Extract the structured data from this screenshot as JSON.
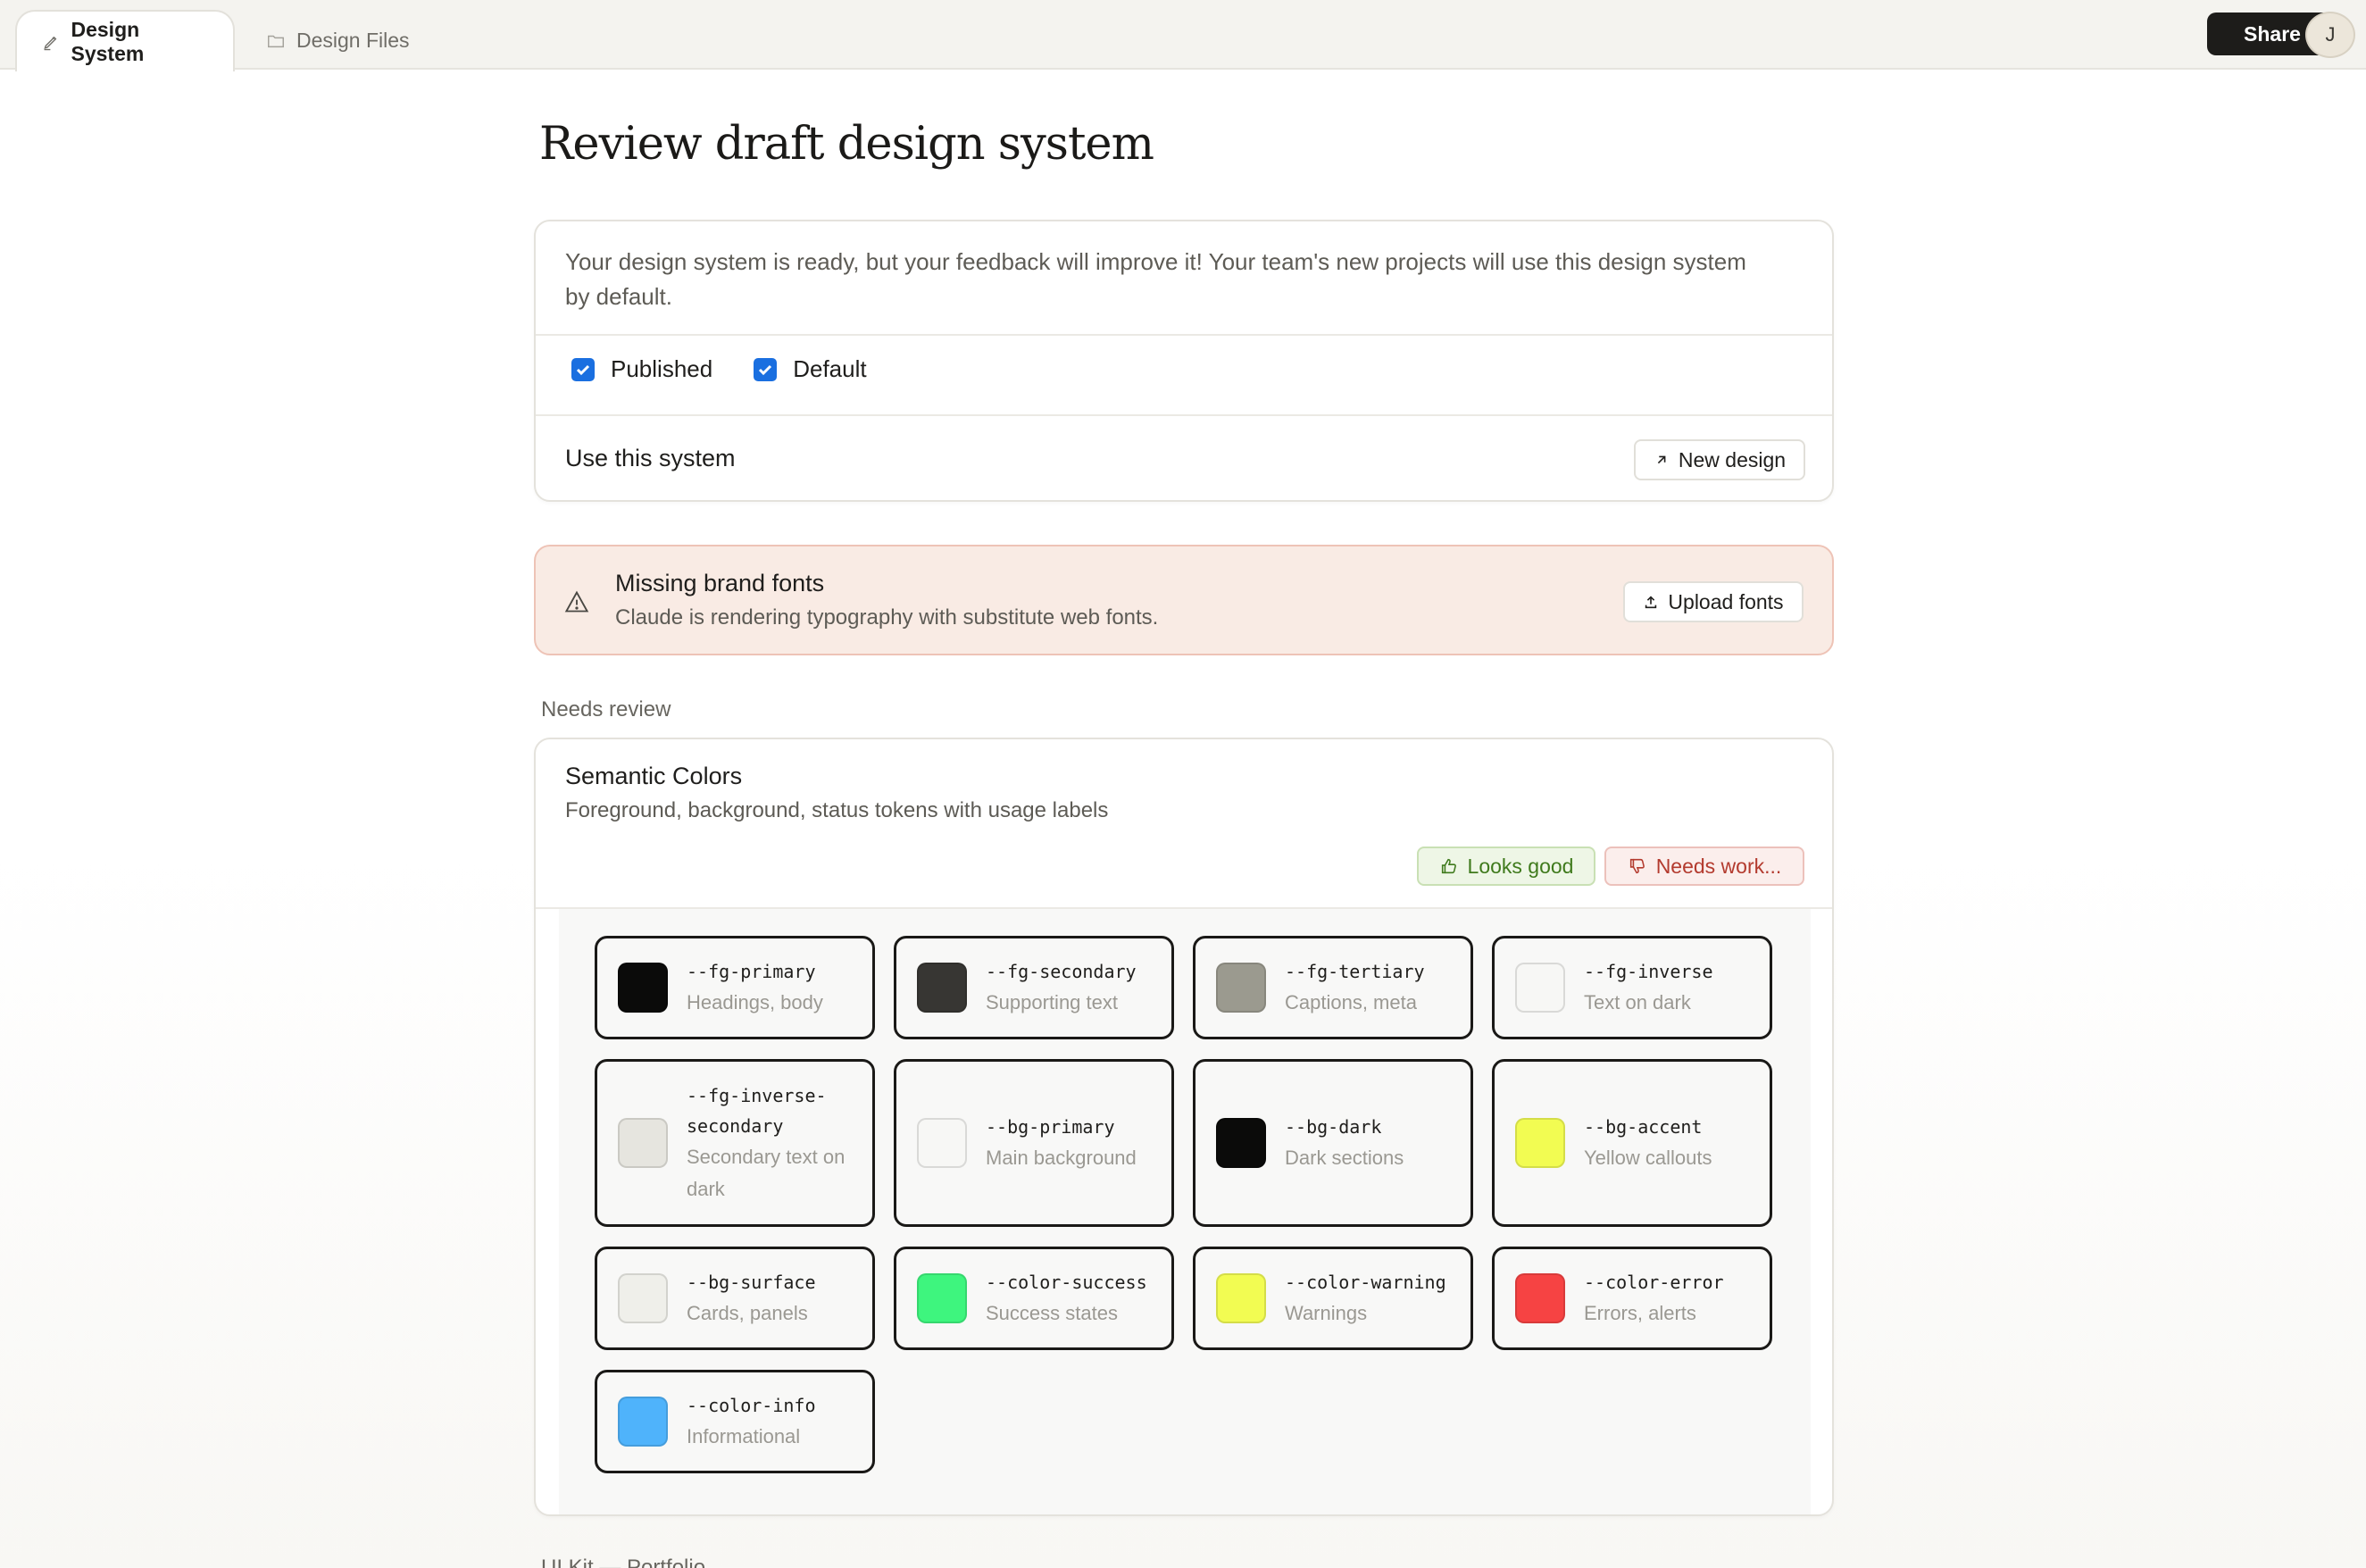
{
  "tabs": [
    {
      "label": "Design System",
      "icon": "pen-icon",
      "active": true
    },
    {
      "label": "Design Files",
      "icon": "folder-icon",
      "active": false
    }
  ],
  "header": {
    "share_label": "Share",
    "avatar_initial": "J"
  },
  "page": {
    "title": "Review draft design system"
  },
  "info": {
    "description": "Your design system is ready, but your feedback will improve it! Your team's new projects will use this design system by default.",
    "published_label": "Published",
    "published_checked": true,
    "default_label": "Default",
    "default_checked": true,
    "use_label": "Use this system",
    "new_design_label": "New design"
  },
  "warning": {
    "title": "Missing brand fonts",
    "description": "Claude is rendering typography with substitute web fonts.",
    "upload_label": "Upload fonts"
  },
  "review": {
    "section_label": "Needs review",
    "card_title": "Semantic Colors",
    "card_subtitle": "Foreground, background, status tokens with usage labels",
    "looks_good_label": "Looks good",
    "needs_work_label": "Needs work..."
  },
  "colors": [
    {
      "token": "--fg-primary",
      "usage": "Headings, body",
      "hex": "#0b0b0a"
    },
    {
      "token": "--fg-secondary",
      "usage": "Supporting text",
      "hex": "#373633"
    },
    {
      "token": "--fg-tertiary",
      "usage": "Captions, meta",
      "hex": "#9b9a8f"
    },
    {
      "token": "--fg-inverse",
      "usage": "Text on dark",
      "hex": "#f7f7f5"
    },
    {
      "token": "--fg-inverse-secondary",
      "usage": "Secondary text on dark",
      "hex": "#e6e5df"
    },
    {
      "token": "--bg-primary",
      "usage": "Main background",
      "hex": "#f7f7f5"
    },
    {
      "token": "--bg-dark",
      "usage": "Dark sections",
      "hex": "#0b0b0a"
    },
    {
      "token": "--bg-accent",
      "usage": "Yellow callouts",
      "hex": "#f2fc52"
    },
    {
      "token": "--bg-surface",
      "usage": "Cards, panels",
      "hex": "#efefea"
    },
    {
      "token": "--color-success",
      "usage": "Success states",
      "hex": "#3ef57e"
    },
    {
      "token": "--color-warning",
      "usage": "Warnings",
      "hex": "#f2fc52"
    },
    {
      "token": "--color-error",
      "usage": "Errors, alerts",
      "hex": "#f64343"
    },
    {
      "token": "--color-info",
      "usage": "Informational",
      "hex": "#4fb3fb"
    }
  ],
  "next_section_label": "UI Kit — Portfolio"
}
